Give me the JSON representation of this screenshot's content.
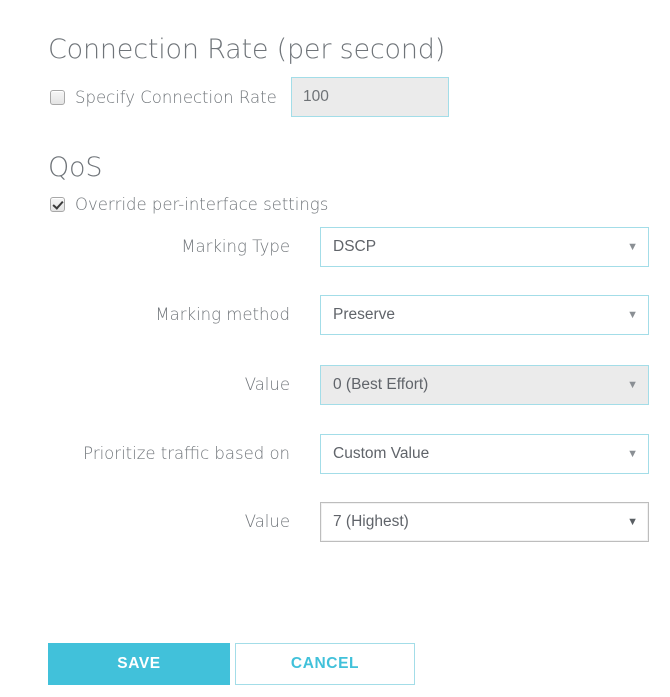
{
  "sections": {
    "connection_rate": {
      "title": "Connection Rate (per second)",
      "checkbox_label": "Specify Connection Rate",
      "checkbox_checked": false,
      "rate_value": "100",
      "rate_placeholder": ""
    },
    "qos": {
      "title": "QoS",
      "checkbox_label": "Override per-interface settings",
      "checkbox_checked": true
    }
  },
  "form_rows": [
    {
      "label": "Marking Type",
      "value": "DSCP",
      "arrow": "▼",
      "style": "teal"
    },
    {
      "label": "Marking method",
      "value": "Preserve",
      "arrow": "▼",
      "style": "teal"
    },
    {
      "label": "Value",
      "value": "0 (Best Effort)",
      "arrow": "▼",
      "style": "teal-disabled"
    },
    {
      "label": "Prioritize traffic based on",
      "value": "Custom Value",
      "arrow": "▼",
      "style": "teal"
    },
    {
      "label": "Value",
      "value": "7 (Highest)",
      "arrow": "▼",
      "style": "plain"
    }
  ],
  "buttons": {
    "save": "SAVE",
    "cancel": "CANCEL"
  },
  "colors": {
    "accent_teal": "#41c1da",
    "accent_border": "#a3dde8",
    "text_gray": "#70757a",
    "disabled_bg": "#ebebeb"
  }
}
